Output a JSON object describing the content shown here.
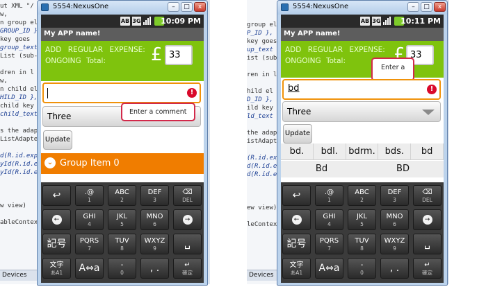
{
  "ide_left": {
    "lines": [
      "ut XML \"/",
      "w,",
      "n group el",
      "GROUP_ID },",
      "key goes",
      "group_text",
      "List (sub-",
      "",
      "dren in l",
      "w,",
      "n child el",
      "HILD_ID },",
      "child key",
      "child_text",
      "",
      "s the adap",
      "ListAdapte",
      "",
      "d(R.id.exp",
      "yId(R.id.e",
      "yId(R.id.e",
      "",
      "",
      "",
      "w view)",
      "",
      "ableContex"
    ],
    "devices_tab": "Devices"
  },
  "ide_right": {
    "lines": [
      "group el",
      "P_ID },",
      "key goes",
      "up_text",
      "ist (sub-",
      "",
      "ren in l",
      "",
      "hild el",
      "D_ID },",
      "ild key",
      "ld_text",
      "",
      "the adap",
      "istAdapte",
      "",
      "(R.id.exp",
      "d(R.id.e",
      "d(R.id.e",
      "",
      "",
      "",
      "ew view)",
      "",
      "leContex"
    ],
    "devices_tab": "Devices"
  },
  "emulator_a": {
    "window_title": "5554:NexusOne",
    "window_buttons": {
      "minimize": "–",
      "maximize": "□",
      "close": "x"
    },
    "status": {
      "ab_icon": "AB",
      "g3_icon": "3G",
      "time": "10:09 PM",
      "signal_icon": "signal-icon",
      "battery_icon": "battery-icon"
    },
    "app_title": "My APP name!",
    "expense_line1": "ADD REGULAR EXPENSE:",
    "expense_line2": "ONGOING Total:",
    "currency": "£",
    "amount": "33",
    "comment_value": "",
    "error_symbol": "!",
    "tooltip": "Enter a comment",
    "spinner_value": "Three",
    "update_label": "Update",
    "group_label": "Group Item 0",
    "group_chevron": "⌄"
  },
  "emulator_b": {
    "window_title": "5554:NexusOne",
    "window_buttons": {
      "minimize": "–",
      "maximize": "□",
      "close": "x"
    },
    "status": {
      "ab_icon": "AB",
      "g3_icon": "3G",
      "time": "10:11 PM",
      "signal_icon": "signal-icon",
      "battery_icon": "battery-icon"
    },
    "app_title": "My APP name!",
    "expense_line1": "ADD REGULAR EXPENSE:",
    "expense_line2": "ONGOING Total:",
    "currency": "£",
    "amount": "33",
    "comment_value": "bd",
    "error_symbol": "!",
    "tooltip": "Enter a",
    "spinner_value": "Three",
    "update_label": "Update",
    "suggestions_row1": [
      "bd.",
      "bdl.",
      "bdrm.",
      "bds.",
      "bd"
    ],
    "suggestions_row2": [
      "Bd",
      "BD"
    ]
  },
  "keyboard": {
    "keys": [
      {
        "main": "↩",
        "sub": "",
        "icon": "undo-icon"
      },
      {
        "main": ".@",
        "sub": "1"
      },
      {
        "main": "ABC",
        "sub": "2"
      },
      {
        "main": "DEF",
        "sub": "3"
      },
      {
        "main": "⌫",
        "sub": "DEL",
        "icon": "delete-icon"
      },
      {
        "main": "←",
        "sub": "",
        "icon": "left-arrow-icon"
      },
      {
        "main": "GHI",
        "sub": "4"
      },
      {
        "main": "JKL",
        "sub": "5"
      },
      {
        "main": "MNO",
        "sub": "6"
      },
      {
        "main": "→",
        "sub": "",
        "icon": "right-arrow-icon"
      },
      {
        "main": "記号",
        "sub": ""
      },
      {
        "main": "PQRS",
        "sub": "7"
      },
      {
        "main": "TUV",
        "sub": "8"
      },
      {
        "main": "WXYZ",
        "sub": "9"
      },
      {
        "main": "␣",
        "sub": "",
        "icon": "space-icon"
      },
      {
        "main": "文字",
        "sub": "あA1"
      },
      {
        "main": "A⇔a",
        "sub": ""
      },
      {
        "main": "-",
        "sub": "0"
      },
      {
        "main": ", .",
        "sub": ""
      },
      {
        "main": "↵",
        "sub": "確定",
        "icon": "enter-icon"
      }
    ]
  }
}
